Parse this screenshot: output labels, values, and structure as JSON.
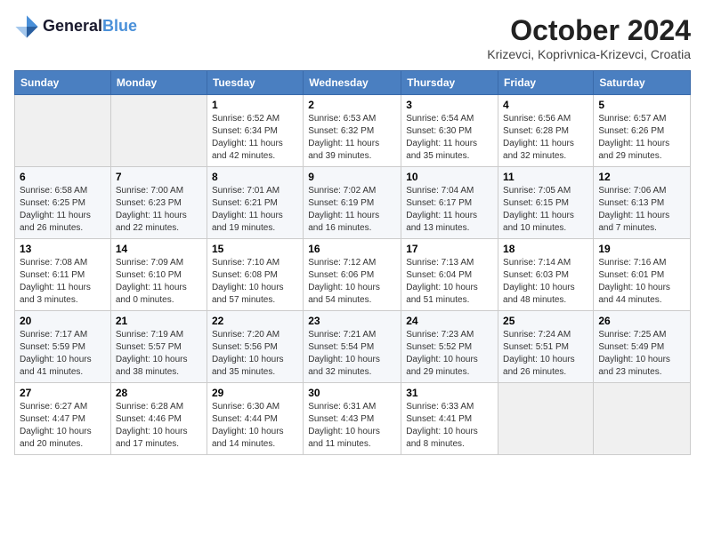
{
  "header": {
    "logo_line1": "General",
    "logo_line2": "Blue",
    "month_title": "October 2024",
    "location": "Krizevci, Koprivnica-Krizevci, Croatia"
  },
  "weekdays": [
    "Sunday",
    "Monday",
    "Tuesday",
    "Wednesday",
    "Thursday",
    "Friday",
    "Saturday"
  ],
  "days": [
    {
      "num": "",
      "info": ""
    },
    {
      "num": "",
      "info": ""
    },
    {
      "num": "1",
      "info": "Sunrise: 6:52 AM\nSunset: 6:34 PM\nDaylight: 11 hours and 42 minutes."
    },
    {
      "num": "2",
      "info": "Sunrise: 6:53 AM\nSunset: 6:32 PM\nDaylight: 11 hours and 39 minutes."
    },
    {
      "num": "3",
      "info": "Sunrise: 6:54 AM\nSunset: 6:30 PM\nDaylight: 11 hours and 35 minutes."
    },
    {
      "num": "4",
      "info": "Sunrise: 6:56 AM\nSunset: 6:28 PM\nDaylight: 11 hours and 32 minutes."
    },
    {
      "num": "5",
      "info": "Sunrise: 6:57 AM\nSunset: 6:26 PM\nDaylight: 11 hours and 29 minutes."
    },
    {
      "num": "6",
      "info": "Sunrise: 6:58 AM\nSunset: 6:25 PM\nDaylight: 11 hours and 26 minutes."
    },
    {
      "num": "7",
      "info": "Sunrise: 7:00 AM\nSunset: 6:23 PM\nDaylight: 11 hours and 22 minutes."
    },
    {
      "num": "8",
      "info": "Sunrise: 7:01 AM\nSunset: 6:21 PM\nDaylight: 11 hours and 19 minutes."
    },
    {
      "num": "9",
      "info": "Sunrise: 7:02 AM\nSunset: 6:19 PM\nDaylight: 11 hours and 16 minutes."
    },
    {
      "num": "10",
      "info": "Sunrise: 7:04 AM\nSunset: 6:17 PM\nDaylight: 11 hours and 13 minutes."
    },
    {
      "num": "11",
      "info": "Sunrise: 7:05 AM\nSunset: 6:15 PM\nDaylight: 11 hours and 10 minutes."
    },
    {
      "num": "12",
      "info": "Sunrise: 7:06 AM\nSunset: 6:13 PM\nDaylight: 11 hours and 7 minutes."
    },
    {
      "num": "13",
      "info": "Sunrise: 7:08 AM\nSunset: 6:11 PM\nDaylight: 11 hours and 3 minutes."
    },
    {
      "num": "14",
      "info": "Sunrise: 7:09 AM\nSunset: 6:10 PM\nDaylight: 11 hours and 0 minutes."
    },
    {
      "num": "15",
      "info": "Sunrise: 7:10 AM\nSunset: 6:08 PM\nDaylight: 10 hours and 57 minutes."
    },
    {
      "num": "16",
      "info": "Sunrise: 7:12 AM\nSunset: 6:06 PM\nDaylight: 10 hours and 54 minutes."
    },
    {
      "num": "17",
      "info": "Sunrise: 7:13 AM\nSunset: 6:04 PM\nDaylight: 10 hours and 51 minutes."
    },
    {
      "num": "18",
      "info": "Sunrise: 7:14 AM\nSunset: 6:03 PM\nDaylight: 10 hours and 48 minutes."
    },
    {
      "num": "19",
      "info": "Sunrise: 7:16 AM\nSunset: 6:01 PM\nDaylight: 10 hours and 44 minutes."
    },
    {
      "num": "20",
      "info": "Sunrise: 7:17 AM\nSunset: 5:59 PM\nDaylight: 10 hours and 41 minutes."
    },
    {
      "num": "21",
      "info": "Sunrise: 7:19 AM\nSunset: 5:57 PM\nDaylight: 10 hours and 38 minutes."
    },
    {
      "num": "22",
      "info": "Sunrise: 7:20 AM\nSunset: 5:56 PM\nDaylight: 10 hours and 35 minutes."
    },
    {
      "num": "23",
      "info": "Sunrise: 7:21 AM\nSunset: 5:54 PM\nDaylight: 10 hours and 32 minutes."
    },
    {
      "num": "24",
      "info": "Sunrise: 7:23 AM\nSunset: 5:52 PM\nDaylight: 10 hours and 29 minutes."
    },
    {
      "num": "25",
      "info": "Sunrise: 7:24 AM\nSunset: 5:51 PM\nDaylight: 10 hours and 26 minutes."
    },
    {
      "num": "26",
      "info": "Sunrise: 7:25 AM\nSunset: 5:49 PM\nDaylight: 10 hours and 23 minutes."
    },
    {
      "num": "27",
      "info": "Sunrise: 6:27 AM\nSunset: 4:47 PM\nDaylight: 10 hours and 20 minutes."
    },
    {
      "num": "28",
      "info": "Sunrise: 6:28 AM\nSunset: 4:46 PM\nDaylight: 10 hours and 17 minutes."
    },
    {
      "num": "29",
      "info": "Sunrise: 6:30 AM\nSunset: 4:44 PM\nDaylight: 10 hours and 14 minutes."
    },
    {
      "num": "30",
      "info": "Sunrise: 6:31 AM\nSunset: 4:43 PM\nDaylight: 10 hours and 11 minutes."
    },
    {
      "num": "31",
      "info": "Sunrise: 6:33 AM\nSunset: 4:41 PM\nDaylight: 10 hours and 8 minutes."
    },
    {
      "num": "",
      "info": ""
    },
    {
      "num": "",
      "info": ""
    }
  ]
}
